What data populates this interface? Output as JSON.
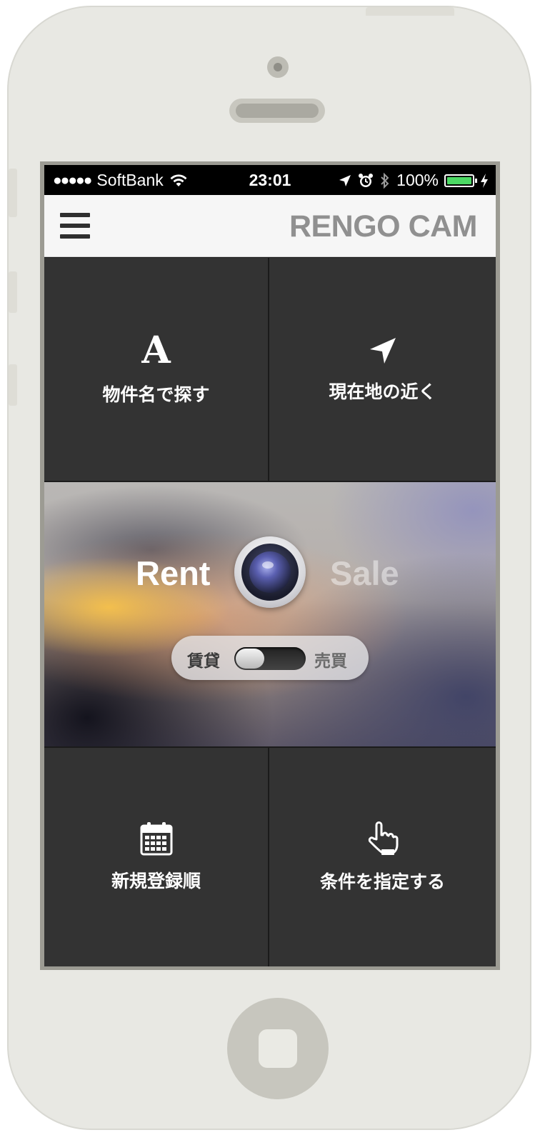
{
  "status_bar": {
    "signal": "●●●●●",
    "carrier": "SoftBank",
    "time": "23:01",
    "battery_percent": "100%",
    "battery_level": 1.0,
    "battery_color": "#4cd964"
  },
  "nav": {
    "title": "RENGO CAM"
  },
  "tiles": {
    "search_by_name": {
      "icon": "letter-a-icon",
      "icon_glyph": "A",
      "label": "物件名で探す"
    },
    "nearby": {
      "icon": "location-arrow-icon",
      "label": "現在地の近く"
    },
    "newest": {
      "icon": "calendar-icon",
      "label": "新規登録順"
    },
    "conditions": {
      "icon": "pointing-hand-icon",
      "label": "条件を指定する"
    }
  },
  "hero": {
    "rent_label": "Rent",
    "sale_label": "Sale",
    "camera_icon": "camera-lens-icon",
    "toggle": {
      "left_label": "賃貸",
      "right_label": "売買",
      "selected": "賃貸"
    }
  },
  "colors": {
    "tile_background": "#333333",
    "nav_background": "#f6f6f6",
    "title_color": "#909090"
  }
}
